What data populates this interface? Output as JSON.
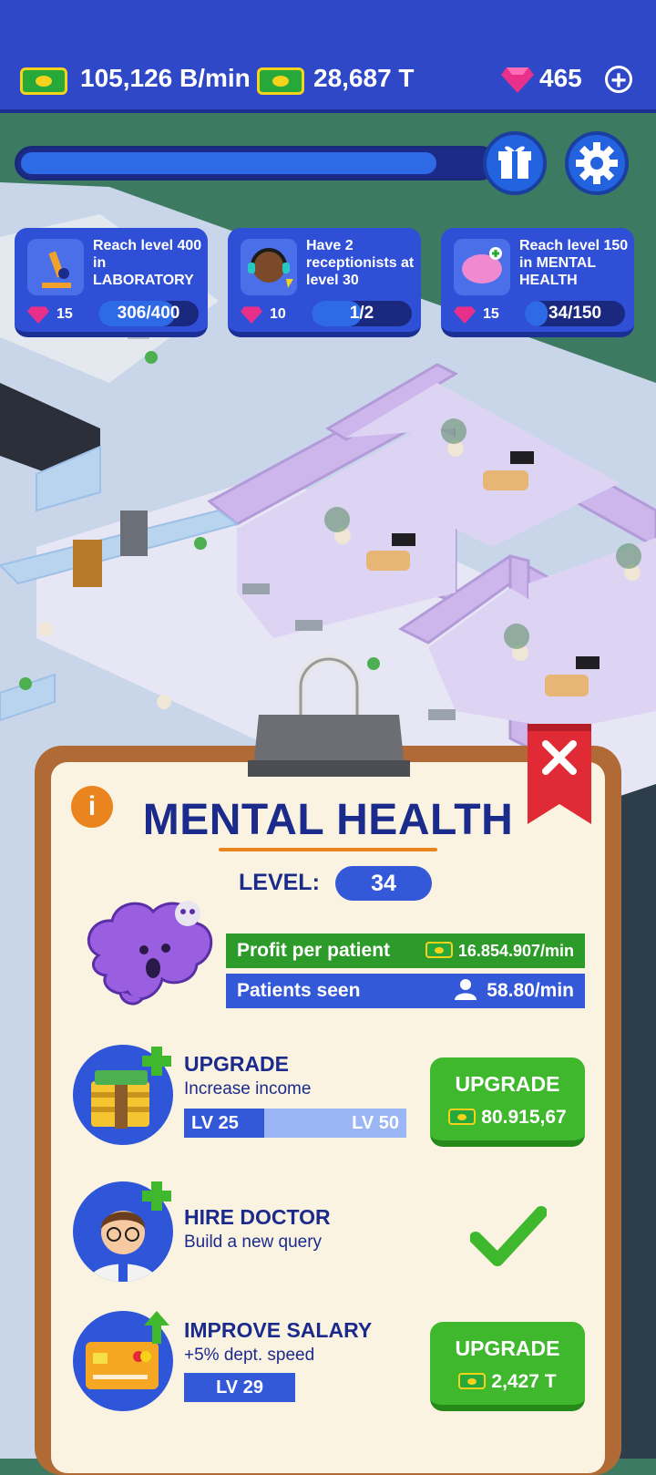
{
  "topbar": {
    "income_rate": "105,126 B/min",
    "cash_total": "28,687 T",
    "gems": "465",
    "level_progress": 0.87
  },
  "quests": [
    {
      "text": "Reach level 400 in LABORATORY",
      "reward": "15",
      "progress_text": "306/400",
      "progress": 0.765,
      "icon": "microscope-icon"
    },
    {
      "text": "Have 2 receptionists at level 30",
      "reward": "10",
      "progress_text": "1/2",
      "progress": 0.5,
      "icon": "receptionist-icon"
    },
    {
      "text": "Reach level 150 in MENTAL HEALTH",
      "reward": "15",
      "progress_text": "34/150",
      "progress": 0.227,
      "icon": "brain-icon"
    }
  ],
  "panel": {
    "title": "MENTAL HEALTH",
    "level_label": "LEVEL:",
    "level_value": "34",
    "profit_label": "Profit per patient",
    "profit_value": "16.854.907/min",
    "patients_label": "Patients seen",
    "patients_value": "58.80/min",
    "upgrade": {
      "title": "UPGRADE",
      "subtitle": "Increase income",
      "lv_current": "LV 25",
      "lv_target": "LV 50",
      "progress": 0.36,
      "button_label": "UPGRADE",
      "cost": "80.915,67"
    },
    "hire": {
      "title": "HIRE DOCTOR",
      "subtitle": "Build a new query",
      "status": "done"
    },
    "salary": {
      "title": "IMPROVE SALARY",
      "subtitle": "+5% dept. speed",
      "level": "LV 29",
      "button_label": "UPGRADE",
      "cost": "2,427 T"
    }
  },
  "colors": {
    "topbar": "#2f48c8",
    "panel_border": "#b06a35",
    "panel_bg": "#fbf3e2",
    "title_blue": "#1b2b8c",
    "green": "#3fb82e",
    "accent_orange": "#e9841e"
  }
}
